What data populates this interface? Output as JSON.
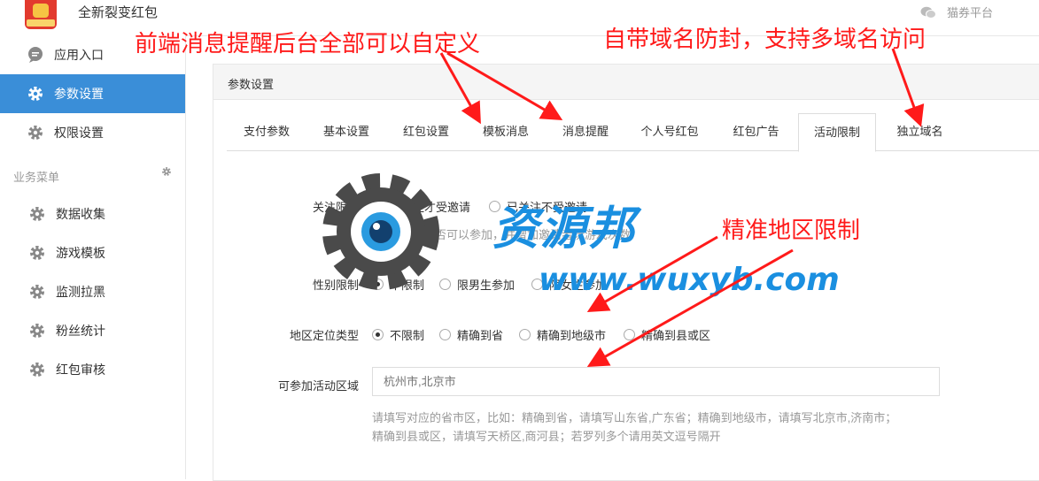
{
  "header": {
    "app_title": "全新裂变红包",
    "platform_label": "猫券平台"
  },
  "sidebar": {
    "items": [
      {
        "label": "应用入口",
        "icon": "chat-bubble-icon"
      },
      {
        "label": "参数设置",
        "icon": "gear-icon",
        "active": true
      },
      {
        "label": "权限设置",
        "icon": "gear-icon"
      }
    ],
    "section_label": "业务菜单",
    "business_items": [
      {
        "label": "数据收集",
        "icon": "gear-icon"
      },
      {
        "label": "游戏模板",
        "icon": "gear-icon"
      },
      {
        "label": "监测拉黑",
        "icon": "gear-icon"
      },
      {
        "label": "粉丝统计",
        "icon": "gear-icon"
      },
      {
        "label": "红包审核",
        "icon": "gear-icon"
      }
    ]
  },
  "panel": {
    "title": "参数设置",
    "tabs": [
      "支付参数",
      "基本设置",
      "红包设置",
      "模板消息",
      "消息提醒",
      "个人号红包",
      "红包广告",
      "活动限制",
      "独立域名"
    ],
    "active_tab": "活动限制"
  },
  "form": {
    "follow_limit": {
      "label": "关注限制",
      "options": [
        "只关注才受邀请",
        "已关注不受邀请"
      ],
      "selected": 0,
      "help": "是否可以参加，并增加邀请者玩游戏次数"
    },
    "gender_limit": {
      "label": "性别限制",
      "options": [
        "不限制",
        "限男生参加",
        "限女生参加"
      ],
      "selected": 0
    },
    "region_type": {
      "label": "地区定位类型",
      "options": [
        "不限制",
        "精确到省",
        "精确到地级市",
        "精确到县或区"
      ],
      "selected": 0
    },
    "region_area": {
      "label": "可参加活动区域",
      "placeholder": "杭州市,北京市",
      "help_line1": "请填写对应的省市区，比如：精确到省，请填写山东省,广东省；精确到地级市，请填写北京市,济南市；",
      "help_line2": "精确到县或区，请填写天桥区,商河县；若罗列多个请用英文逗号隔开"
    }
  },
  "annotations": {
    "front_end": "前端消息提醒后台全部可以自定义",
    "domain": "自带域名防封，支持多域名访问",
    "region": "精准地区限制",
    "color": "#ff1a1a"
  },
  "watermark": {
    "text": "资源邦",
    "url": "www.wuxyb.com",
    "color": "#1a8fe0"
  }
}
